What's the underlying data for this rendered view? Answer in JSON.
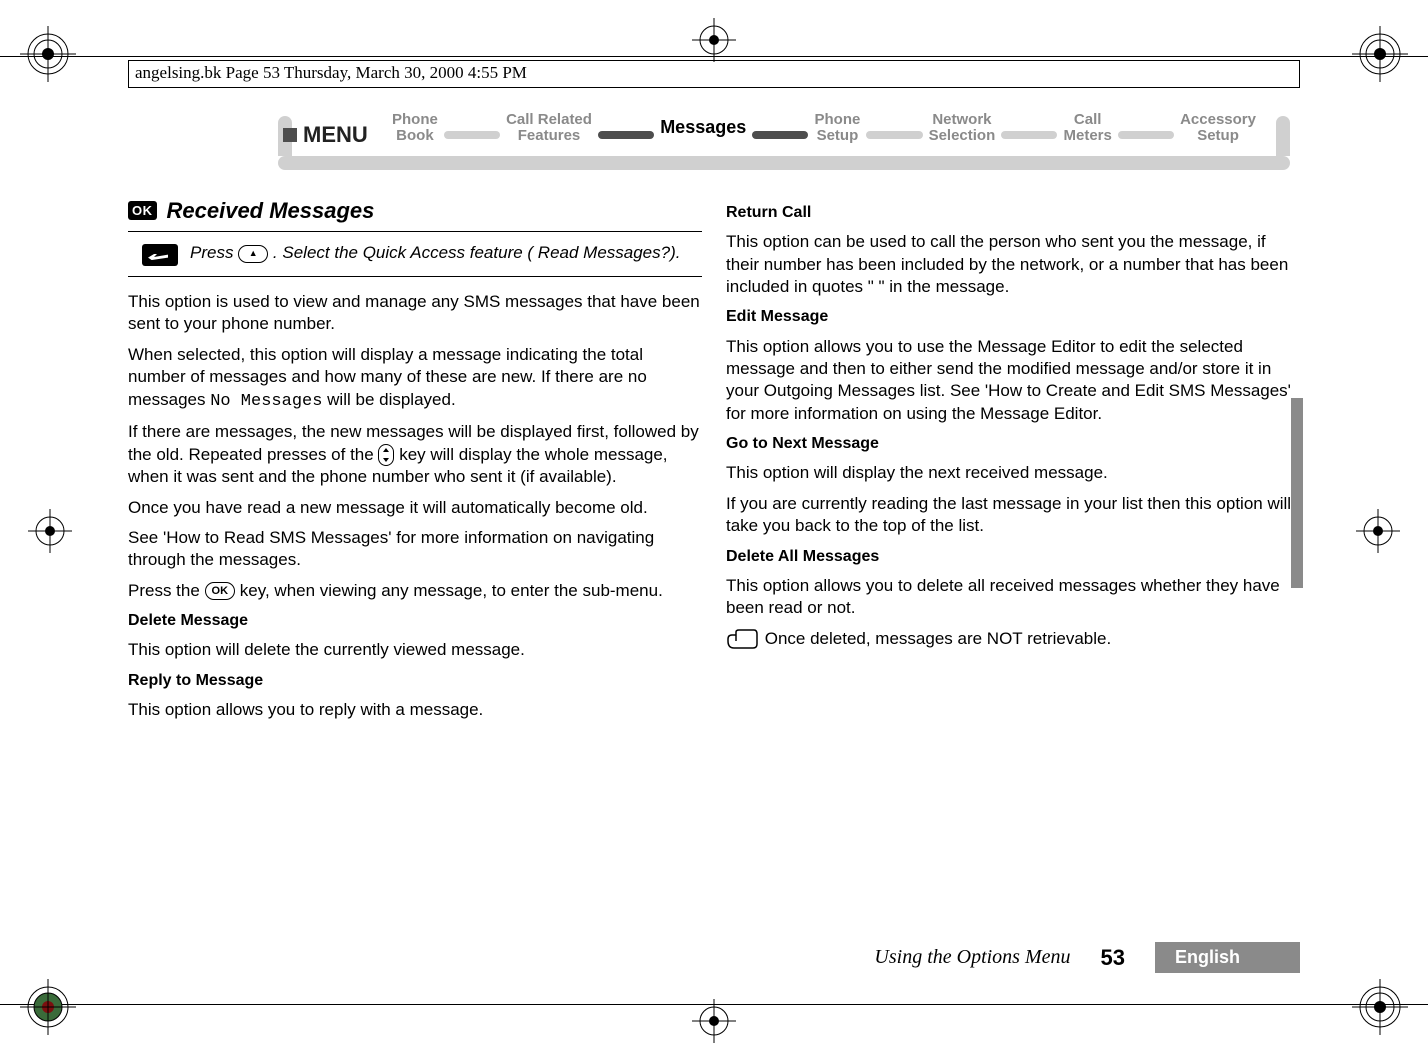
{
  "file_header": "angelsing.bk  Page 53  Thursday, March 30, 2000  4:55 PM",
  "ribbon": {
    "menu_label": "MENU",
    "items": [
      {
        "line1": "Phone",
        "line2": "Book"
      },
      {
        "line1": "Call Related",
        "line2": "Features"
      },
      {
        "line1": "Messages",
        "line2": ""
      },
      {
        "line1": "Phone",
        "line2": "Setup"
      },
      {
        "line1": "Network",
        "line2": "Selection"
      },
      {
        "line1": "Call",
        "line2": "Meters"
      },
      {
        "line1": "Accessory",
        "line2": "Setup"
      }
    ]
  },
  "left": {
    "ok_badge": "OK",
    "section_title": "Received Messages",
    "quick_press": "Press ",
    "quick_rest": ". Select the Quick Access feature ( Read Messages?).",
    "p1": "This option is used to view and manage any SMS messages that have been sent to your phone number.",
    "p2a": "When selected, this option will display a message indicating the total number of messages and how many of these are new. If there are no messages ",
    "p2_code": "No Messages",
    "p2b": " will be displayed.",
    "p3a": "If there are messages, the new messages will be displayed first, followed by the old. Repeated presses of the ",
    "p3b": " key will display the whole message, when it was sent and the phone number who sent it (if available).",
    "p4": "Once you have read a new message it will automatically become old.",
    "p5": "See 'How to Read SMS Messages' for more information on navigating through the messages.",
    "p6a": "Press the ",
    "p6_key": "OK",
    "p6b": " key, when viewing any message, to enter the sub-menu.",
    "delete_h": "Delete Message",
    "delete_p": "This option will delete the currently viewed message.",
    "reply_h": "Reply to Message",
    "reply_p": "This option allows you to reply with a message."
  },
  "right": {
    "return_h": "Return Call",
    "return_p": "This option can be used to call the person who sent you the message, if their number has been included by the network, or a number that has been included in quotes \" \" in the message.",
    "edit_h": "Edit Message",
    "edit_p": "This option allows you to use the Message Editor to edit the selected message and then to either send the modified message and/or store it in your Outgoing Messages list. See 'How to Create and Edit SMS Messages' for more information on using the Message Editor.",
    "goto_h": "Go to Next Message",
    "goto_p1": "This option will display the next received message.",
    "goto_p2": "If you are currently reading the last message in your list then this option will take you back to the top of the list.",
    "delall_h": "Delete All Messages",
    "delall_p": "This option allows you to delete all received messages whether they have been read or not.",
    "note": "Once deleted, messages are NOT retrievable."
  },
  "footer": {
    "section": "Using the Options Menu",
    "page": "53",
    "language": "English"
  }
}
